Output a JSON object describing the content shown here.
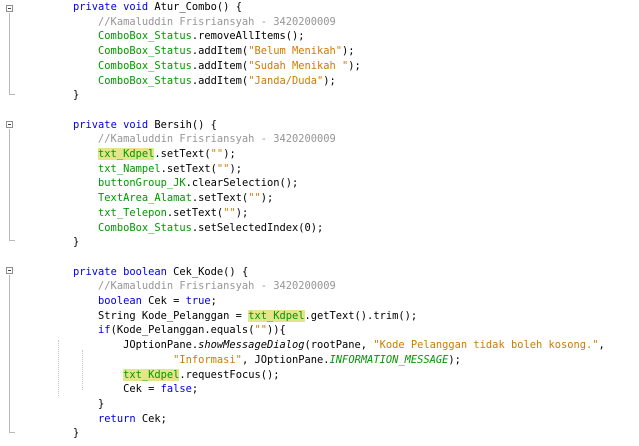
{
  "lines": [
    [
      {
        "t": "    "
      },
      {
        "t": "private void",
        "c": "kw"
      },
      {
        "t": " Atur_Combo() {"
      }
    ],
    [
      {
        "t": "        "
      },
      {
        "t": "//Kamaluddin Frisriansyah - 3420200009",
        "c": "cm"
      }
    ],
    [
      {
        "t": "        "
      },
      {
        "t": "ComboBox_Status",
        "c": "fld"
      },
      {
        "t": ".removeAllItems();"
      }
    ],
    [
      {
        "t": "        "
      },
      {
        "t": "ComboBox_Status",
        "c": "fld"
      },
      {
        "t": ".addItem("
      },
      {
        "t": "\"Belum Menikah\"",
        "c": "str"
      },
      {
        "t": ");"
      }
    ],
    [
      {
        "t": "        "
      },
      {
        "t": "ComboBox_Status",
        "c": "fld"
      },
      {
        "t": ".addItem("
      },
      {
        "t": "\"Sudah Menikah \"",
        "c": "str"
      },
      {
        "t": ");"
      }
    ],
    [
      {
        "t": "        "
      },
      {
        "t": "ComboBox_Status",
        "c": "fld"
      },
      {
        "t": ".addItem("
      },
      {
        "t": "\"Janda/Duda\"",
        "c": "str"
      },
      {
        "t": ");"
      }
    ],
    [
      {
        "t": "    }"
      }
    ],
    [],
    [
      {
        "t": "    "
      },
      {
        "t": "private void",
        "c": "kw"
      },
      {
        "t": " Bersih() {"
      }
    ],
    [
      {
        "t": "        "
      },
      {
        "t": "//Kamaluddin Frisriansyah - 3420200009",
        "c": "cm"
      }
    ],
    [
      {
        "t": "        "
      },
      {
        "t": "txt_Kdpel",
        "c": "fld hl"
      },
      {
        "t": ".setText("
      },
      {
        "t": "\"\"",
        "c": "str"
      },
      {
        "t": ");"
      }
    ],
    [
      {
        "t": "        "
      },
      {
        "t": "txt_Nampel",
        "c": "fld"
      },
      {
        "t": ".setText("
      },
      {
        "t": "\"\"",
        "c": "str"
      },
      {
        "t": ");"
      }
    ],
    [
      {
        "t": "        "
      },
      {
        "t": "buttonGroup_JK",
        "c": "fld"
      },
      {
        "t": ".clearSelection();"
      }
    ],
    [
      {
        "t": "        "
      },
      {
        "t": "TextArea_Alamat",
        "c": "fld"
      },
      {
        "t": ".setText("
      },
      {
        "t": "\"\"",
        "c": "str"
      },
      {
        "t": ");"
      }
    ],
    [
      {
        "t": "        "
      },
      {
        "t": "txt_Telepon",
        "c": "fld"
      },
      {
        "t": ".setText("
      },
      {
        "t": "\"\"",
        "c": "str"
      },
      {
        "t": ");"
      }
    ],
    [
      {
        "t": "        "
      },
      {
        "t": "ComboBox_Status",
        "c": "fld"
      },
      {
        "t": ".setSelectedIndex(0);"
      }
    ],
    [
      {
        "t": "    }"
      }
    ],
    [],
    [
      {
        "t": "    "
      },
      {
        "t": "private boolean",
        "c": "kw"
      },
      {
        "t": " Cek_Kode() {"
      }
    ],
    [
      {
        "t": "        "
      },
      {
        "t": "//Kamaluddin Frisriansyah - 3420200009",
        "c": "cm"
      }
    ],
    [
      {
        "t": "        "
      },
      {
        "t": "boolean",
        "c": "kw"
      },
      {
        "t": " Cek = "
      },
      {
        "t": "true",
        "c": "kw"
      },
      {
        "t": ";"
      }
    ],
    [
      {
        "t": "        String Kode_Pelanggan = "
      },
      {
        "t": "txt_Kdpel",
        "c": "fld hl"
      },
      {
        "t": ".getText().trim();"
      }
    ],
    [
      {
        "t": "        "
      },
      {
        "t": "if",
        "c": "kw"
      },
      {
        "t": "(Kode_Pelanggan.equals("
      },
      {
        "t": "\"\"",
        "c": "str"
      },
      {
        "t": ")){"
      }
    ],
    [
      {
        "t": "            JOptionPane."
      },
      {
        "t": "showMessageDialog",
        "c": "it"
      },
      {
        "t": "(rootPane, "
      },
      {
        "t": "\"Kode Pelanggan tidak boleh kosong.\"",
        "c": "str"
      },
      {
        "t": ","
      }
    ],
    [
      {
        "t": "                    "
      },
      {
        "t": "\"Informasi\"",
        "c": "str"
      },
      {
        "t": ", JOptionPane."
      },
      {
        "t": "INFORMATION_MESSAGE",
        "c": "cst"
      },
      {
        "t": ");"
      }
    ],
    [
      {
        "t": "            "
      },
      {
        "t": "txt_Kdpel",
        "c": "fld hl"
      },
      {
        "t": ".requestFocus();"
      }
    ],
    [
      {
        "t": "            Cek = "
      },
      {
        "t": "false",
        "c": "kw"
      },
      {
        "t": ";"
      }
    ],
    [
      {
        "t": "        }"
      }
    ],
    [
      {
        "t": "        "
      },
      {
        "t": "return",
        "c": "kw"
      },
      {
        "t": " Cek;"
      }
    ],
    [
      {
        "t": "    }"
      }
    ]
  ]
}
